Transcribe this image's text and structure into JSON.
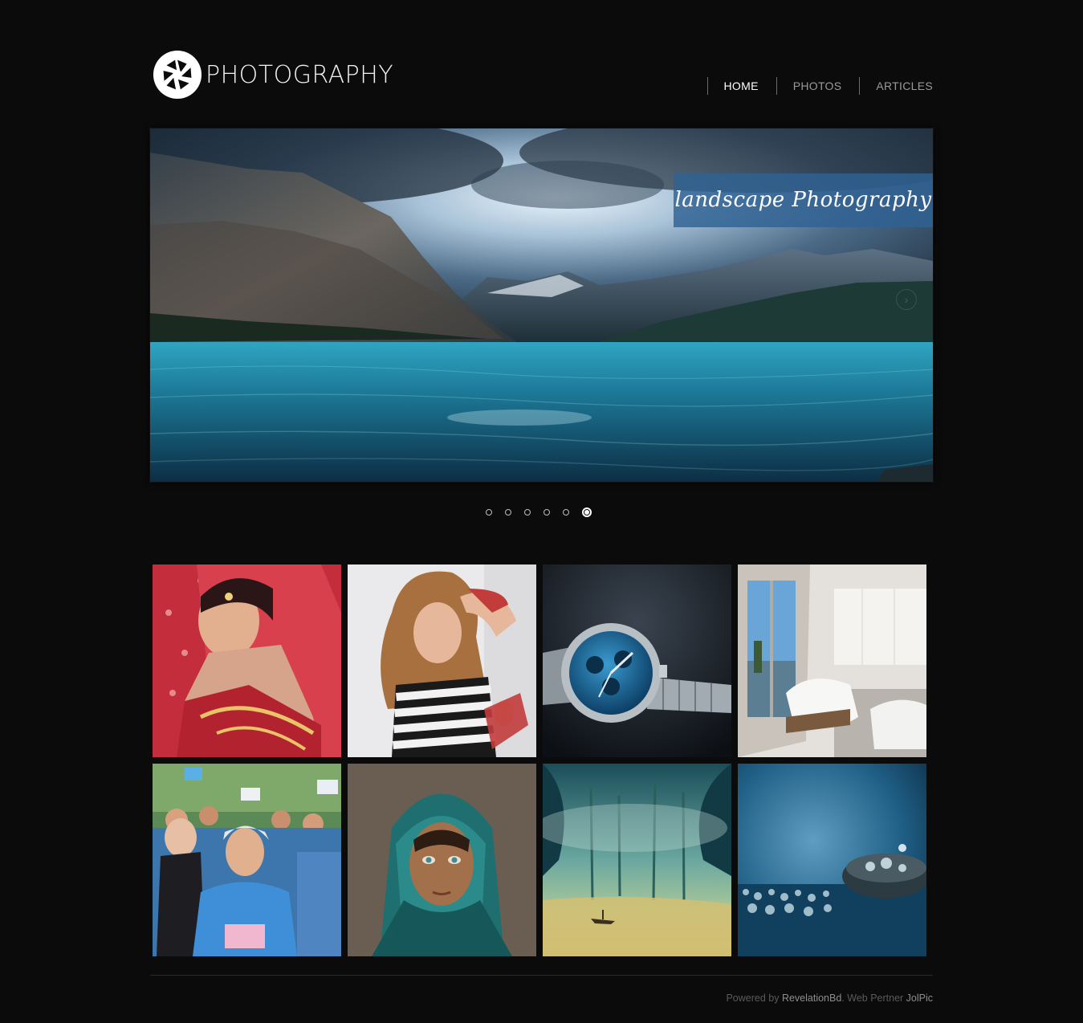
{
  "header": {
    "logo_text": "PHOTOGRAPHY",
    "nav": [
      {
        "label": "HOME",
        "active": true
      },
      {
        "label": "PHOTOS",
        "active": false
      },
      {
        "label": "ARTICLES",
        "active": false
      }
    ]
  },
  "slider": {
    "caption": "landscape Photography",
    "slide_count": 6,
    "active_slide": 6,
    "next_icon": "chevron-right-icon"
  },
  "gallery": {
    "tiles": [
      {
        "subject": "bride-portrait"
      },
      {
        "subject": "striped-top-portrait"
      },
      {
        "subject": "wristwatch"
      },
      {
        "subject": "living-room-interior"
      },
      {
        "subject": "march-crowd"
      },
      {
        "subject": "headscarf-portrait"
      },
      {
        "subject": "misty-forest-lake"
      },
      {
        "subject": "water-drops-macro"
      }
    ]
  },
  "footer": {
    "prefix": "Powered by ",
    "company": "RevelationBd",
    "separator": ". Web Pertner ",
    "partner": "JolPic"
  },
  "colors": {
    "background": "#0b0b0c",
    "caption_bg": "#306294",
    "nav_active": "#ffffff",
    "nav_inactive": "#9a9a9a"
  }
}
